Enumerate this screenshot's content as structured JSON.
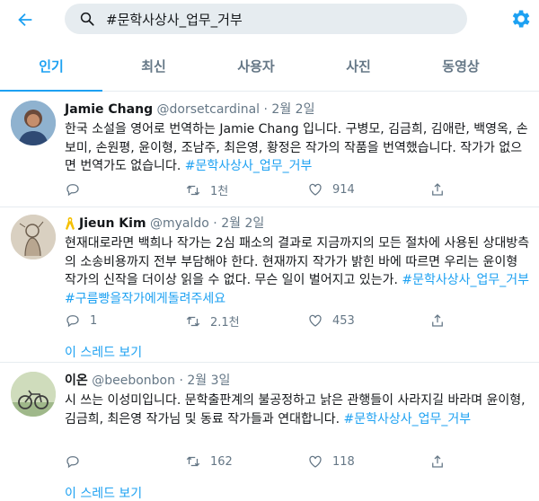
{
  "search": {
    "query": "#문학사상사_업무_거부"
  },
  "tabs": [
    "인기",
    "최신",
    "사용자",
    "사진",
    "동영상"
  ],
  "tweets": [
    {
      "name": "Jamie Chang",
      "handle": "@dorsetcardinal",
      "dot": "·",
      "date": "2월 2일",
      "text_plain": "한국 소설을 영어로 번역하는 Jamie Chang 입니다. 구병모, 김금희, 김애란, 백영옥, 손보미, 손원평, 윤이형, 조남주, 최은영, 황정은 작가의 작품을 번역했습니다. 작가가 없으면 번역가도 없습니다. ",
      "hashtags": "#문학사상사_업무_거부",
      "reply_count": "",
      "retweet_count": "1천",
      "like_count": "914"
    },
    {
      "name": "Jieun Kim",
      "handle": "@myaldo",
      "dot": "·",
      "date": "2월 2일",
      "text_plain": "현재대로라면 백희나 작가는 2심 패소의 결과로 지금까지의 모든 절차에 사용된 상대방측의 소송비용까지 전부 부담해야 한다. 현재까지 작가가 밝힌 바에 따르면 우리는 윤이형 작가의 신작을 더이상 읽을 수 없다. 무슨 일이 벌어지고 있는가. ",
      "hashtags": "#문학사상사_업무_거부 #구름빵을작가에게돌려주세요",
      "reply_count": "1",
      "retweet_count": "2.1천",
      "like_count": "453",
      "thread_label": "이 스레드 보기"
    },
    {
      "name": "이온",
      "handle": "@beebonbon",
      "dot": "·",
      "date": "2월 3일",
      "text_plain": "시 쓰는 이성미입니다. 문학출판계의 불공정하고 낡은 관행들이 사라지길 바라며 윤이형, 김금희, 최은영 작가님 및 동료 작가들과 연대합니다. ",
      "hashtags": "#문학사상사_업무_거부",
      "reply_count": "",
      "retweet_count": "162",
      "like_count": "118",
      "thread_label": "이 스레드 보기"
    }
  ],
  "colors": {
    "accent": "#1da1f2",
    "muted": "#657786",
    "text": "#14171a",
    "border": "#e6ecf0",
    "ribbon": "#f5c000"
  },
  "icons": [
    "back-arrow-icon",
    "search-icon",
    "gear-icon",
    "reply-icon",
    "retweet-icon",
    "like-icon",
    "share-icon",
    "yellow-ribbon-icon"
  ]
}
